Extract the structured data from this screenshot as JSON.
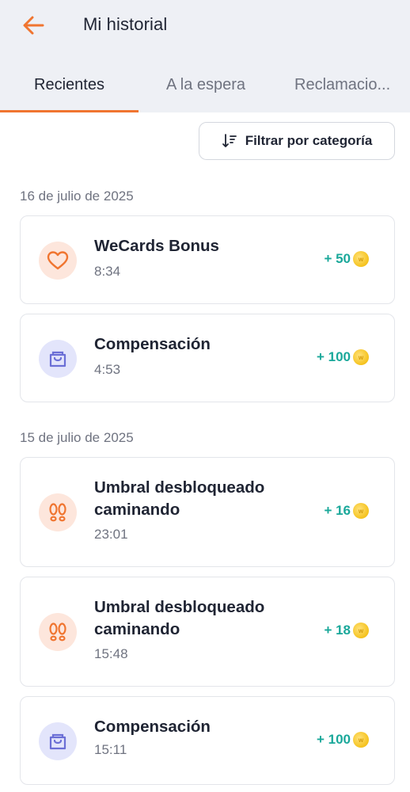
{
  "header": {
    "title": "Mi historial",
    "back_icon": "arrow-left-icon",
    "accent": "#f07530"
  },
  "tabs": [
    {
      "label": "Recientes",
      "active": true
    },
    {
      "label": "A la espera",
      "active": false
    },
    {
      "label": "Reclamacio...",
      "active": false
    }
  ],
  "filter": {
    "label": "Filtrar por categoría",
    "icon": "sort-icon"
  },
  "groups": [
    {
      "date": "16 de julio de 2025",
      "items": [
        {
          "title": "WeCards Bonus",
          "time": "8:34",
          "reward": "+ 50",
          "icon": "heart-icon"
        },
        {
          "title": "Compensación",
          "time": "4:53",
          "reward": "+ 100",
          "icon": "shopping-bag-icon"
        }
      ]
    },
    {
      "date": "15 de julio de 2025",
      "items": [
        {
          "title": "Umbral desbloqueado caminando",
          "time": "23:01",
          "reward": "+ 16",
          "icon": "footsteps-icon"
        },
        {
          "title": "Umbral desbloqueado caminando",
          "time": "15:48",
          "reward": "+ 18",
          "icon": "footsteps-icon"
        },
        {
          "title": "Compensación",
          "time": "15:11",
          "reward": "+ 100",
          "icon": "shopping-bag-icon"
        }
      ]
    }
  ],
  "coin_icon": "coin-icon",
  "colors": {
    "reward": "#1aa89a",
    "tab_indicator": "#f07530"
  }
}
